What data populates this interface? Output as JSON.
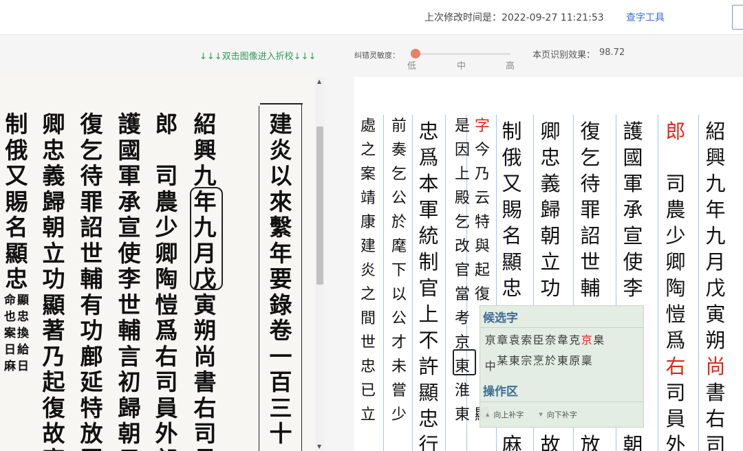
{
  "topbar": {
    "modified_label": "上次修改时间是：",
    "modified_time": "2022-09-27 11:21:53",
    "tool_link": "查字工具"
  },
  "controls": {
    "hint": "↓↓↓双击图像进入折校↓↓↓",
    "sensitivity_label": "纠错灵敏度：",
    "sensitivity_level": "低",
    "ticks": [
      "低",
      "中",
      "高"
    ],
    "recognition_label": "本页识别效果：",
    "recognition_value": "98.72"
  },
  "scan": {
    "columns": [
      "建炎以來繫年要錄卷一百三十二",
      "紹興九年九月戊寅朔尚書右司員",
      "郎　司農少卿陶愷爲右司員外郎",
      "護國軍承宣使李世輔言初歸朝日",
      "復乞待罪詔世輔有功鄜延特放罪",
      "卿忠義歸朝立功顯著乃起復故官",
      "制俄又賜名顯忠"
    ],
    "small_lines": [
      "顯忠換給日",
      "命也案日麻",
      "麻不"
    ]
  },
  "text": {
    "columns": [
      {
        "chars": "紹興九年九月戊寅朔尚書右司",
        "red": [
          9
        ]
      },
      {
        "chars": "郎　司農少卿陶愷爲右司員外",
        "red": [
          0,
          9
        ]
      },
      {
        "chars": "護國軍承宣使李　　　　　朝",
        "red": []
      },
      {
        "chars": "復乞待罪詔世輔　　　　　放",
        "red": []
      },
      {
        "chars": "卿忠義歸朝立功　　　　　故",
        "red": []
      },
      {
        "chars": "制俄又賜名顯忠　　　　　麻",
        "red": []
      },
      {
        "chars": "字今乃云特與起復　　　　顯",
        "red": [
          0
        ]
      },
      {
        "chars": "是因上殿乞改官當考京東淮東",
        "red": []
      },
      {
        "chars": "忠爲本軍統制官上不許顯忠行",
        "red": []
      },
      {
        "chars": "前奏乞公於麾下以公才未嘗少",
        "red": []
      },
      {
        "chars": "處之案靖康建炎之間世忠已立",
        "red": []
      }
    ]
  },
  "popup": {
    "candidates_title": "候选字",
    "candidates": [
      "亰",
      "章",
      "袁",
      "索",
      "臣",
      "奈",
      "韋",
      "克",
      "京",
      "臬",
      "中",
      "某",
      "東",
      "宗",
      "烹",
      "於",
      "東",
      "原",
      "稟"
    ],
    "selected_candidate": "京",
    "ops_title": "操作区",
    "op_up": "向上补字",
    "op_down": "向下补字"
  }
}
